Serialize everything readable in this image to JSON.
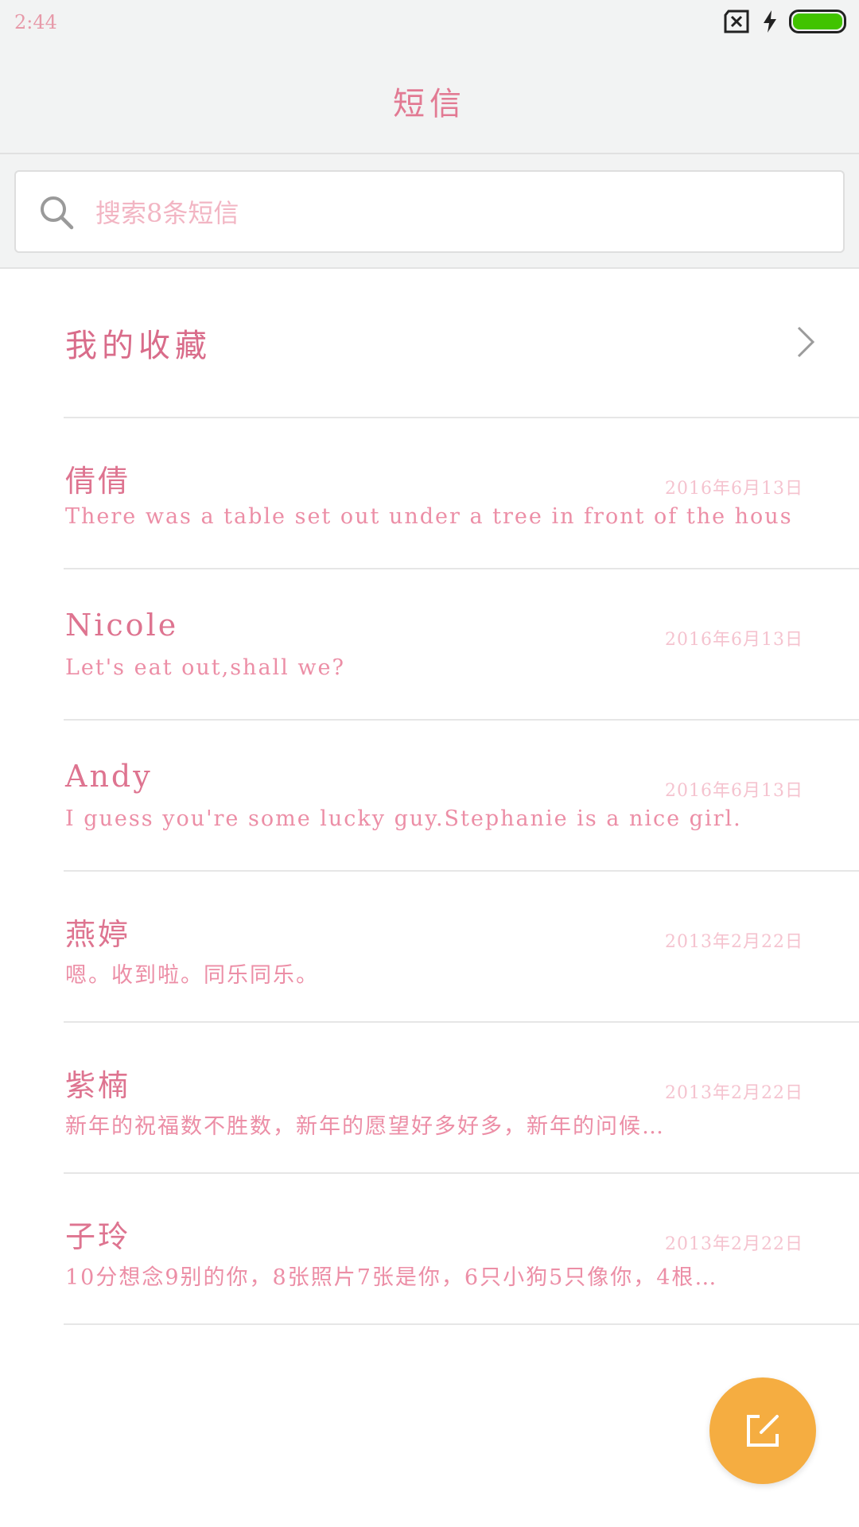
{
  "status": {
    "time": "2:44"
  },
  "header": {
    "title": "短信"
  },
  "search": {
    "placeholder": "搜索8条短信"
  },
  "favorites": {
    "label": "我的收藏"
  },
  "messages": [
    {
      "name": "倩倩",
      "date": "2016年6月13日",
      "preview": "There was a table set out under a tree in front of the hous"
    },
    {
      "name": "Nicole",
      "date": "2016年6月13日",
      "preview": "Let's eat out,shall we?"
    },
    {
      "name": "Andy",
      "date": "2016年6月13日",
      "preview": "I guess you're some lucky guy.Stephanie is a nice girl."
    },
    {
      "name": "燕婷",
      "date": "2013年2月22日",
      "preview": "嗯。收到啦。同乐同乐。"
    },
    {
      "name": "紫楠",
      "date": "2013年2月22日",
      "preview": "新年的祝福数不胜数，新年的愿望好多好多，新年的问候…"
    },
    {
      "name": "子玲",
      "date": "2013年2月22日",
      "preview": "10分想念9别的你，8张照片7张是你，6只小狗5只像你，4根…"
    }
  ],
  "colors": {
    "accent": "#e27a93",
    "fab": "#f5ad41",
    "battery": "#41c300"
  },
  "icons": {
    "search": "search-icon",
    "chevron": "chevron-right-icon",
    "compose": "compose-icon",
    "sim": "sim-off-icon",
    "charging": "charging-icon",
    "battery": "battery-icon"
  }
}
